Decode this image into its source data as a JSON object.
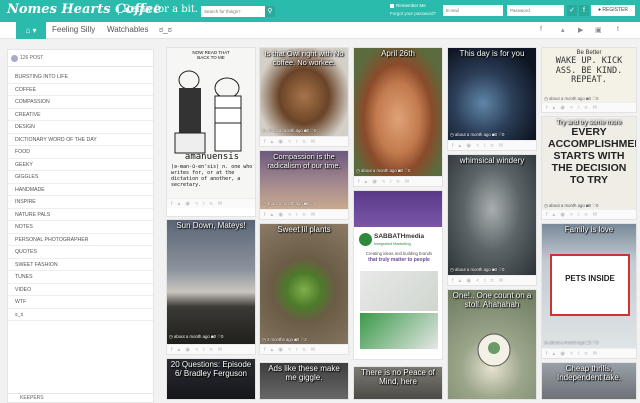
{
  "header": {
    "logo": "Nomes Hearts Coffee",
    "tagline": "Relax for a bit.",
    "search_placeholder": "Search for things?",
    "search_icon": "search-icon",
    "remember_me": "Remember Me",
    "forgot_password": "Forgot your password?",
    "email_placeholder": "E-mail",
    "password_placeholder": "Password",
    "register_label": "REGISTER",
    "colors": {
      "accent": "#2bbbad"
    }
  },
  "nav": {
    "home_icon": "home-icon",
    "items": [
      "Feeling Silly",
      "Watchables",
      "ಠ_ಠ"
    ],
    "social_icons": [
      "facebook-icon",
      "twitter-icon",
      "youtube-icon",
      "instagram-icon",
      "tumblr-icon"
    ]
  },
  "sidebar": {
    "post_count": "126 POST",
    "categories": [
      "BURSTING INTO LIFE",
      "COFFEE",
      "COMPASSION",
      "CREATIVE",
      "DESIGN",
      "DICTIONARY WORD OF THE DAY",
      "FOOD",
      "GEEKY",
      "GIGGLES",
      "HANDMADE",
      "INSPIRE",
      "NATURE PALS",
      "NOTES",
      "PERSONAL PHOTOGRAPHER",
      "QUOTES",
      "SWEET FASHION",
      "TUNES",
      "VIDEO",
      "WTF",
      "ಠ_ಠ"
    ],
    "footer_label": "KEEPERS"
  },
  "posts": {
    "p1": {
      "caption": "amanuensis",
      "cartoon_text": "NOW READ THAT BACK TO ME",
      "definition": "(ə-man-ū-en'sis) n. one who writes for, or at the dictation of another, a secretary."
    },
    "p2": {
      "title": "Is that Owl right with No coffee. No workee.",
      "meta": "about a month ago"
    },
    "p3": {
      "title": "April 26th",
      "meta": "about a month ago"
    },
    "p4": {
      "title": "This day is for you",
      "meta": "about a month ago"
    },
    "p5": {
      "title": "Be Better",
      "tile_text": "WAKE UP. KICK ASS. BE KIND. REPEAT.",
      "meta": "about a month ago"
    },
    "p6": {
      "title": "Compassion is the radicalism of our time.",
      "meta": "about a month ago"
    },
    "p7": {
      "title": "whimsical windery",
      "meta": "about a month ago"
    },
    "p8": {
      "title": "Try and try some more",
      "tile_text": "EVERY ACCOMPLISHMENT STARTS WITH THE DECISION TO TRY",
      "meta": "about a month ago"
    },
    "p9": {
      "title": "Sun Down, Mateys!",
      "meta": "about a month ago"
    },
    "p10": {
      "title": "Sweet lil plants",
      "meta": "2 months ago"
    },
    "p11": {
      "brand": "SABBATHmedia",
      "sub": "Integrated Marketing",
      "line1": "Creating ideas and building brands",
      "line2": "that truly matter to people",
      "meta": "about a month ago"
    },
    "p12": {
      "title": "One!.. One count on a stoll. Ahahahah",
      "meta": "2 months ago"
    },
    "p13": {
      "title": "Family is love",
      "sign": "PETS INSIDE",
      "meta": "about a month ago"
    },
    "p14": {
      "title": "20 Questions: Episode 6/ Bradley Ferguson"
    },
    "p15": {
      "title": "Ads like these make me giggle."
    },
    "p16": {
      "title": "There is no Peace of Mind, here"
    },
    "p17": {
      "title": "Cheap thrills, Independent take."
    }
  }
}
